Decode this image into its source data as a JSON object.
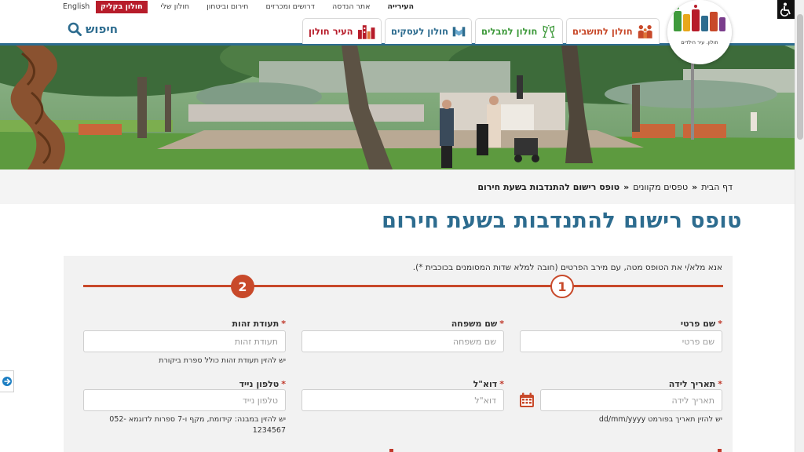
{
  "topbar": {
    "nav": [
      "העירייה",
      "אתר הנדסה",
      "דרושים ומכרזים",
      "חירום וביטחון",
      "חולון שלי"
    ],
    "holon_click": "חולון בקליק",
    "english": "English"
  },
  "header": {
    "nav_buttons": [
      {
        "label": "חולון לתושבים",
        "icon": "family-icon",
        "color": "#c8492a"
      },
      {
        "label": "חולון למבלים",
        "icon": "cheers-icon",
        "color": "#3f9a3c"
      },
      {
        "label": "חולון לעסקים",
        "icon": "handshake-icon",
        "color": "#2d6c8f"
      },
      {
        "label": "העיר חולון",
        "icon": "city-icon",
        "color": "#b71c2a"
      }
    ],
    "search_label": "חיפוש",
    "logo_caption": "חולון. עיר הילדים"
  },
  "breadcrumb": {
    "items": [
      "דף הבית",
      "טפסים מקוונים",
      "טופס רישום להתנדבות בשעת חירום"
    ],
    "separator": "»"
  },
  "page": {
    "title": "טופס רישום להתנדבות בשעת חירום"
  },
  "form": {
    "intro": "אנא מלא/י את הטופס מטה, עם מירב הפרטים (חובה למלא שדות המסומנים בכוכבית *).",
    "required_mark": "*",
    "steps": [
      "1",
      "2"
    ],
    "current_step": 1,
    "fields": {
      "first_name": {
        "label": "שם פרטי",
        "placeholder": "שם פרטי",
        "value": ""
      },
      "last_name": {
        "label": "שם משפחה",
        "placeholder": "שם משפחה",
        "value": ""
      },
      "id_number": {
        "label": "תעודת זהות",
        "placeholder": "תעודת זהות",
        "value": "",
        "hint": "יש להזין תעודת זהות כולל ספרת ביקורת"
      },
      "birth_date": {
        "label": "תאריך לידה",
        "placeholder": "תאריך לידה",
        "value": "",
        "hint": "יש להזין תאריך בפורמט dd/mm/yyyy"
      },
      "email": {
        "label": "דוא\"ל",
        "placeholder": "דוא\"ל",
        "value": ""
      },
      "mobile": {
        "label": "טלפון נייד",
        "placeholder": "טלפון נייד",
        "value": "",
        "hint": "יש להזין במבנה: קידומת, מקף ו-7 ספרות לדוגמא 052-1234567"
      }
    }
  },
  "colors": {
    "accent_blue": "#2d6c8f",
    "accent_orange": "#c8492a",
    "accent_red": "#b71c2a",
    "accent_green": "#3f9a3c"
  }
}
